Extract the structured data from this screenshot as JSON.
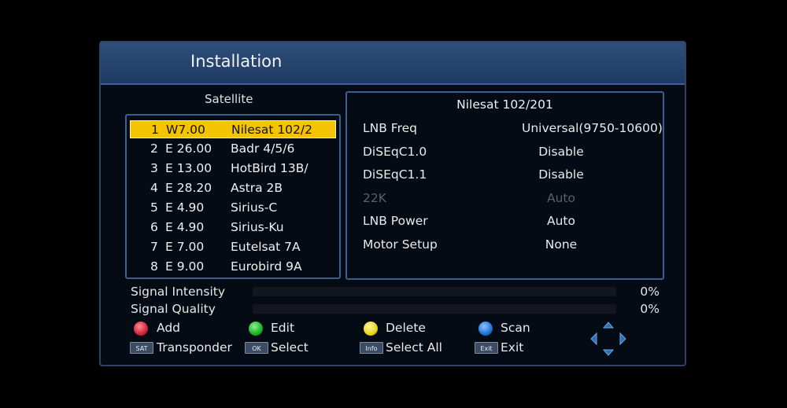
{
  "window": {
    "title": "Installation"
  },
  "satellite_panel": {
    "heading": "Satellite",
    "items": [
      {
        "idx": "1",
        "pos": "W7.00",
        "name": "Nilesat 102/2",
        "selected": true
      },
      {
        "idx": "2",
        "pos": "E 26.00",
        "name": "Badr 4/5/6"
      },
      {
        "idx": "3",
        "pos": "E 13.00",
        "name": "HotBird 13B/"
      },
      {
        "idx": "4",
        "pos": "E 28.20",
        "name": "Astra 2B"
      },
      {
        "idx": "5",
        "pos": "E 4.90",
        "name": "Sirius-C"
      },
      {
        "idx": "6",
        "pos": "E 4.90",
        "name": "Sirius-Ku"
      },
      {
        "idx": "7",
        "pos": "E 7.00",
        "name": "Eutelsat 7A"
      },
      {
        "idx": "8",
        "pos": "E 9.00",
        "name": "Eurobird 9A"
      }
    ]
  },
  "details": {
    "title": "Nilesat 102/201",
    "rows": [
      {
        "label": "LNB Freq",
        "value": "Universal(9750-10600)",
        "enabled": true
      },
      {
        "label": "DiSEqC1.0",
        "value": "Disable",
        "enabled": true
      },
      {
        "label": "DiSEqC1.1",
        "value": "Disable",
        "enabled": true
      },
      {
        "label": "22K",
        "value": "Auto",
        "enabled": false
      },
      {
        "label": "LNB Power",
        "value": "Auto",
        "enabled": true
      },
      {
        "label": "Motor Setup",
        "value": "None",
        "enabled": true
      }
    ]
  },
  "signal": {
    "intensity": {
      "label": "Signal Intensity",
      "percent_text": "0%",
      "fill": 0
    },
    "quality": {
      "label": "Signal Quality",
      "percent_text": "0%",
      "fill": 0
    }
  },
  "keys": {
    "red": "Add",
    "green": "Edit",
    "yellow": "Delete",
    "blue": "Scan",
    "sat_btn": "SAT",
    "sat": "Transponder",
    "ok_btn": "OK",
    "ok": "Select",
    "info_btn": "Info",
    "info": "Select All",
    "exit_btn": "Exit",
    "exit": "Exit"
  },
  "colors": {
    "title_bar": "#2f4f7a",
    "selection": "#f5c400",
    "panel_border": "#3c5f8e",
    "red": "#d3243a",
    "green": "#18b324",
    "yellow": "#e8d51c",
    "blue": "#1f72d8"
  }
}
